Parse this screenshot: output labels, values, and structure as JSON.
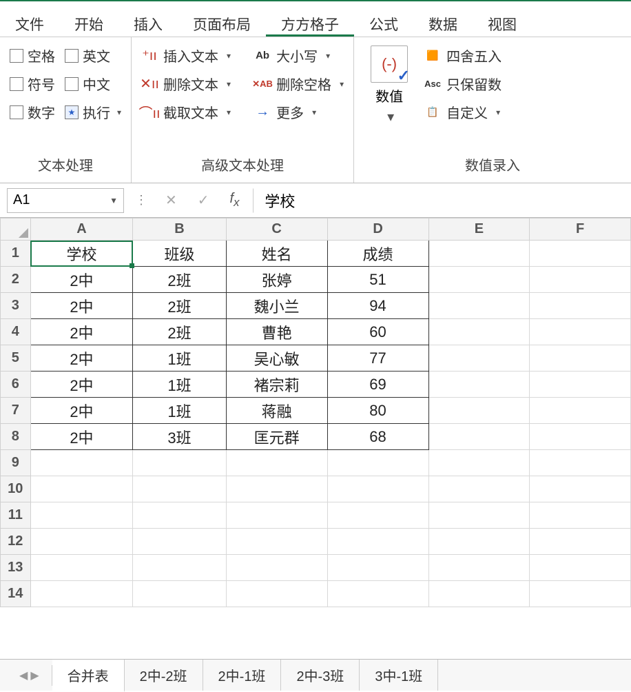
{
  "menu": {
    "tabs": [
      "文件",
      "开始",
      "插入",
      "页面布局",
      "方方格子",
      "公式",
      "数据",
      "视图"
    ],
    "active_index": 4
  },
  "ribbon": {
    "group1": {
      "label": "文本处理",
      "items": [
        "空格",
        "英文",
        "符号",
        "中文",
        "数字",
        "执行"
      ]
    },
    "group2": {
      "label": "高级文本处理",
      "col_a": [
        "插入文本",
        "删除文本",
        "截取文本"
      ],
      "col_b": [
        "大小写",
        "删除空格",
        "更多"
      ]
    },
    "group3": {
      "label": "数值录入",
      "big_button": "数值",
      "items": [
        "四舍五入",
        "只保留数",
        "自定义"
      ]
    }
  },
  "formula_bar": {
    "name_box": "A1",
    "formula": "学校"
  },
  "grid": {
    "columns": [
      "A",
      "B",
      "C",
      "D",
      "E",
      "F"
    ],
    "row_count": 14,
    "selected": "A1",
    "headers": [
      "学校",
      "班级",
      "姓名",
      "成绩"
    ],
    "data": [
      [
        "2中",
        "2班",
        "张婷",
        "51"
      ],
      [
        "2中",
        "2班",
        "魏小兰",
        "94"
      ],
      [
        "2中",
        "2班",
        "曹艳",
        "60"
      ],
      [
        "2中",
        "1班",
        "吴心敏",
        "77"
      ],
      [
        "2中",
        "1班",
        "褚宗莉",
        "69"
      ],
      [
        "2中",
        "1班",
        "蒋融",
        "80"
      ],
      [
        "2中",
        "3班",
        "匡元群",
        "68"
      ]
    ]
  },
  "sheet_tabs": {
    "tabs": [
      "合并表",
      "2中-2班",
      "2中-1班",
      "2中-3班",
      "3中-1班"
    ],
    "active_index": 0
  }
}
